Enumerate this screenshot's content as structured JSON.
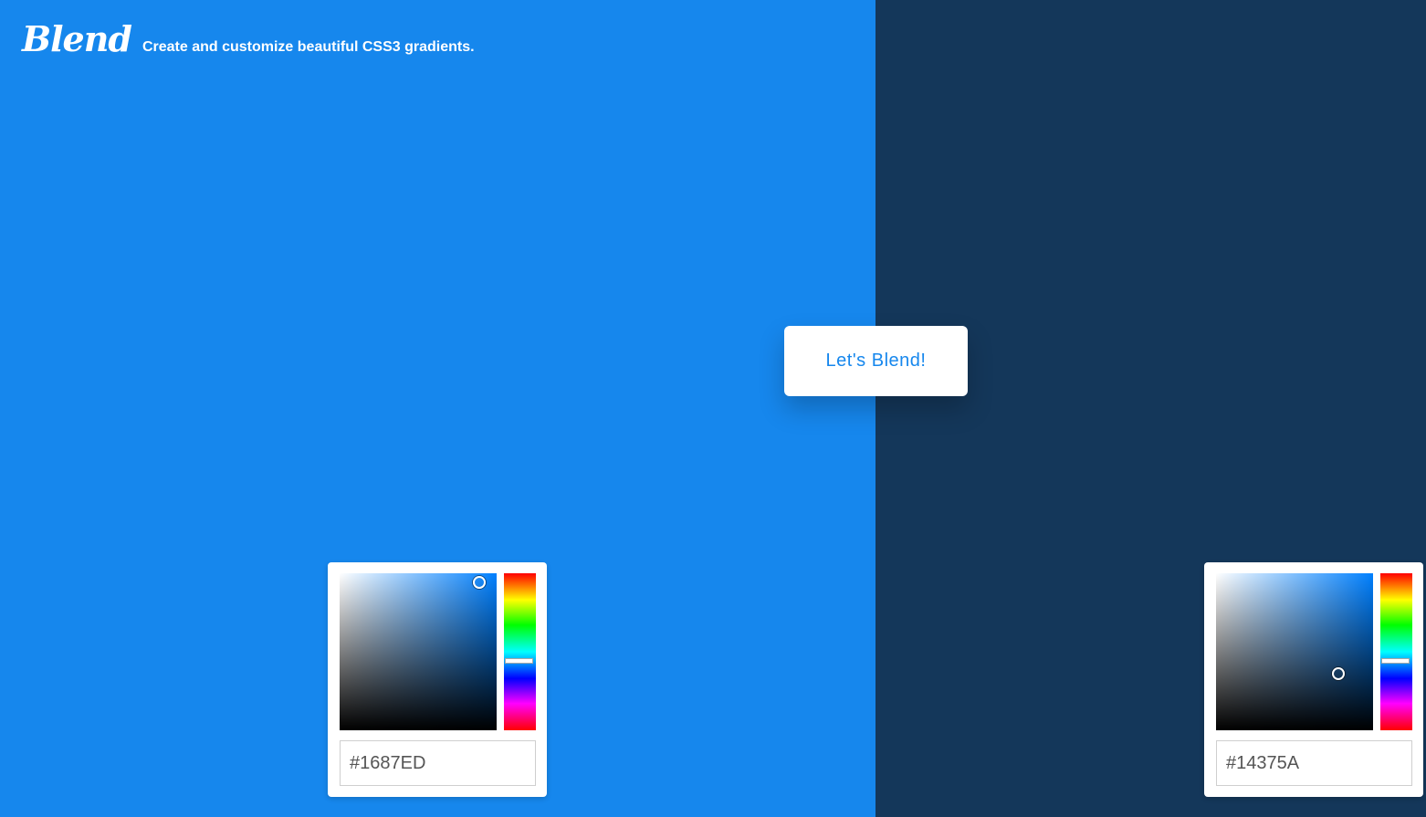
{
  "header": {
    "logo": "Blend",
    "tagline": "Create and customize beautiful CSS3 gradients."
  },
  "colors": {
    "left_panel": "#1687ED",
    "right_panel": "#14375A",
    "accent": "#1687ED"
  },
  "action": {
    "blend_label": "Let's Blend!"
  },
  "pickers": [
    {
      "hex": "#1687ED",
      "hue_level": 0.56,
      "saturation": 0.89,
      "brightness": 0.94
    },
    {
      "hex": "#14375A",
      "hue_level": 0.56,
      "saturation": 0.78,
      "brightness": 0.36
    }
  ],
  "icons": [
    "color-field-handle-icon",
    "hue-slider-handle-icon"
  ]
}
